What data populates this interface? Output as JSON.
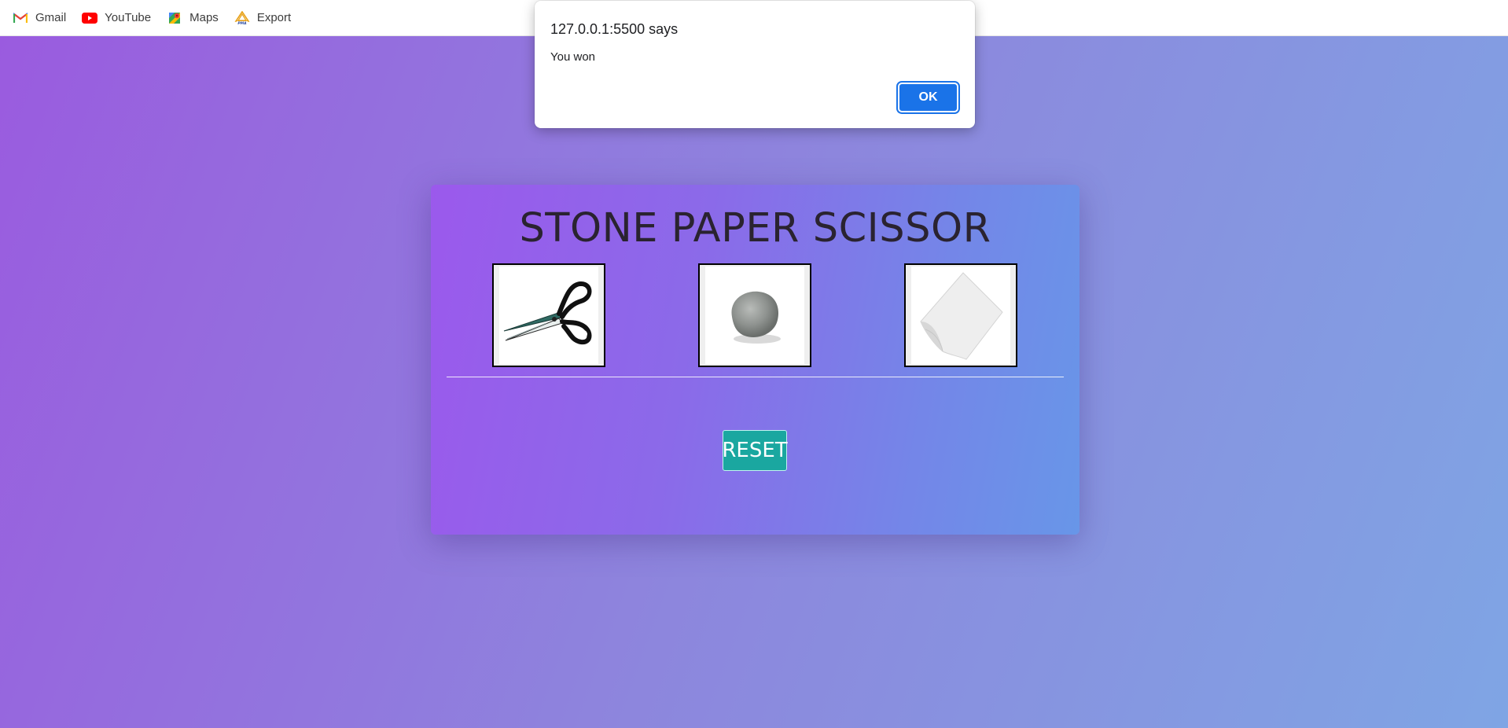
{
  "bookmarks": [
    {
      "label": "Gmail",
      "icon": "gmail-icon"
    },
    {
      "label": "YouTube",
      "icon": "youtube-icon"
    },
    {
      "label": "Maps",
      "icon": "maps-icon"
    },
    {
      "label": "Export",
      "icon": "pma-icon"
    }
  ],
  "alert": {
    "origin": "127.0.0.1:5500 says",
    "message": "You won",
    "ok_label": "OK"
  },
  "game": {
    "title": "STONE PAPER SCISSOR",
    "choices": [
      {
        "name": "scissor",
        "icon": "scissors-image"
      },
      {
        "name": "stone",
        "icon": "stone-image"
      },
      {
        "name": "paper",
        "icon": "paper-image"
      }
    ],
    "reset_label": "RESET"
  },
  "colors": {
    "background_start": "#9a5bdf",
    "background_end": "#7fa5e4",
    "card_start": "#9b59ec",
    "card_end": "#6896e8",
    "reset_button": "#1aa7a0",
    "alert_ok": "#1a73e8"
  }
}
